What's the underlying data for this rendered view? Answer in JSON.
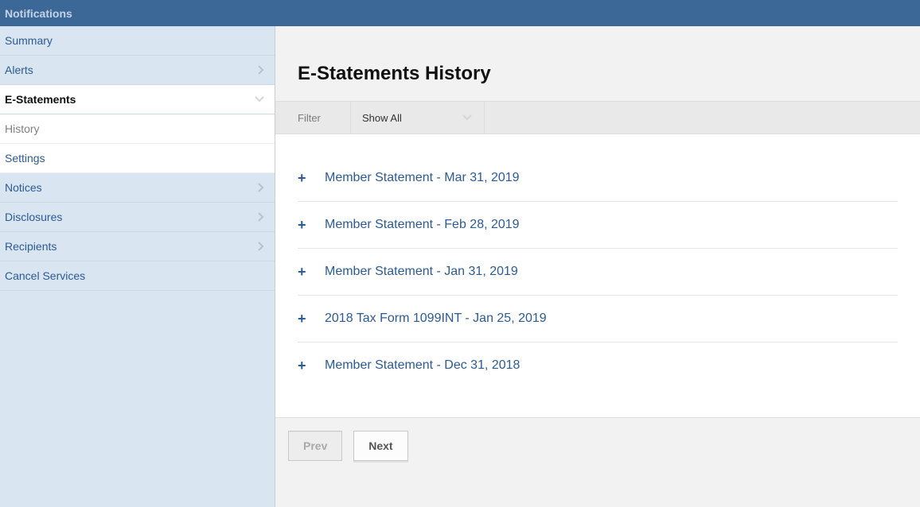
{
  "header": {
    "title": "Notifications"
  },
  "sidebar": {
    "items": [
      {
        "label": "Summary",
        "type": "normal"
      },
      {
        "label": "Alerts",
        "type": "normal",
        "chevron": true
      },
      {
        "label": "E-Statements",
        "type": "active",
        "chevron": true
      },
      {
        "label": "History",
        "type": "sub"
      },
      {
        "label": "Settings",
        "type": "sub link"
      },
      {
        "label": "Notices",
        "type": "normal",
        "chevron": true
      },
      {
        "label": "Disclosures",
        "type": "normal",
        "chevron": true
      },
      {
        "label": "Recipients",
        "type": "normal",
        "chevron": true
      },
      {
        "label": "Cancel Services",
        "type": "normal"
      }
    ]
  },
  "main": {
    "title": "E-Statements History",
    "filter_label": "Filter",
    "filter_value": "Show All"
  },
  "statements": [
    {
      "label": "Member Statement - Mar 31, 2019"
    },
    {
      "label": "Member Statement - Feb 28, 2019"
    },
    {
      "label": "Member Statement - Jan 31, 2019"
    },
    {
      "label": "2018 Tax Form 1099INT - Jan 25, 2019"
    },
    {
      "label": "Member Statement - Dec 31, 2018"
    }
  ],
  "pager": {
    "prev": "Prev",
    "next": "Next"
  }
}
